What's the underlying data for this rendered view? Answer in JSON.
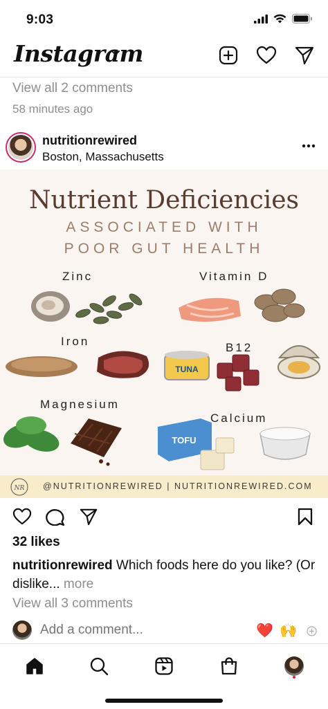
{
  "status_bar": {
    "time": "9:03"
  },
  "header": {
    "logo": "Instagram"
  },
  "prev_post": {
    "view_comments": "View all 2 comments",
    "timestamp": "58 minutes ago"
  },
  "post": {
    "username": "nutritionrewired",
    "location": "Boston, Massachusetts",
    "image": {
      "title": "Nutrient Deficiencies",
      "subtitle_line1": "ASSOCIATED WITH",
      "subtitle_line2": "POOR GUT HEALTH",
      "nutrients": {
        "zinc": "Zinc",
        "vitamin_d": "Vitamin D",
        "iron": "Iron",
        "b12": "B12",
        "magnesium": "Magnesium",
        "calcium": "Calcium"
      },
      "food_labels": {
        "tuna": "TUNA",
        "tofu": "TOFU"
      },
      "footer": "@NUTRITIONREWIRED | NUTRITIONREWIRED.COM",
      "footer_logo": "NR"
    },
    "likes": "32 likes",
    "caption_user": "nutritionrewired",
    "caption_text": "Which foods here do you like? (Or dislike...",
    "caption_more": "more",
    "view_comments": "View all 3 comments",
    "add_comment_placeholder": "Add a comment...",
    "quick_reactions": [
      "❤️",
      "🙌"
    ]
  },
  "icons": {
    "header": [
      "new-post-icon",
      "heart-icon",
      "direct-message-icon"
    ],
    "actions": [
      "like-icon",
      "comment-icon",
      "share-icon",
      "bookmark-icon"
    ],
    "tabs": [
      "home-icon",
      "search-icon",
      "reels-icon",
      "shop-icon",
      "profile-avatar"
    ]
  }
}
